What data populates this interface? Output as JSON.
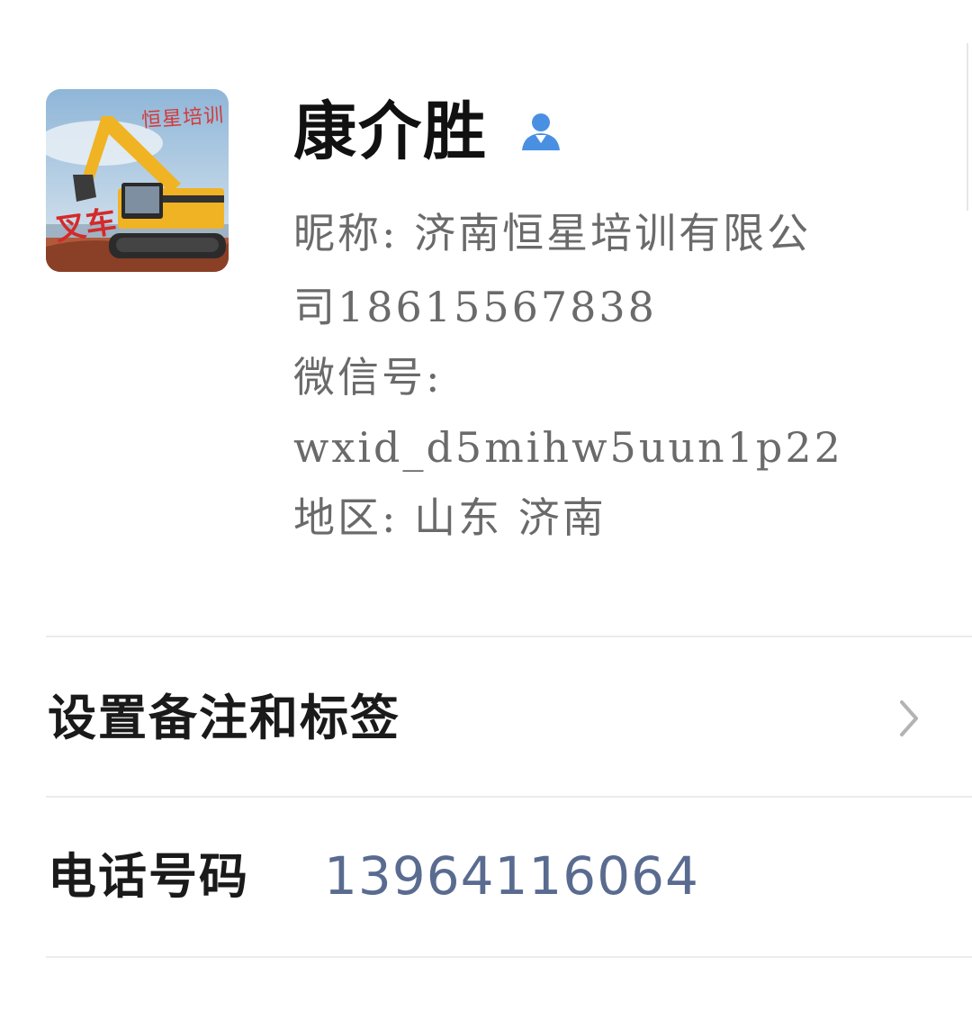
{
  "profile": {
    "name": "康介胜",
    "nickname_line1": "昵称: 济南恒星培训有限公",
    "nickname_line2": "司18615567838",
    "wechat_label": "微信号:",
    "wechat_id": "wxid_d5mihw5uun1p22",
    "region": "地区: 山东  济南",
    "avatar_text_top": "恒星培训",
    "avatar_text_bottom": "叉车"
  },
  "rows": {
    "remark_label": "设置备注和标签",
    "phone_label": "电话号码",
    "phone_value": "13964116064"
  },
  "colors": {
    "accent_blue": "#4a90e2",
    "phone_link": "#5a6b90"
  }
}
